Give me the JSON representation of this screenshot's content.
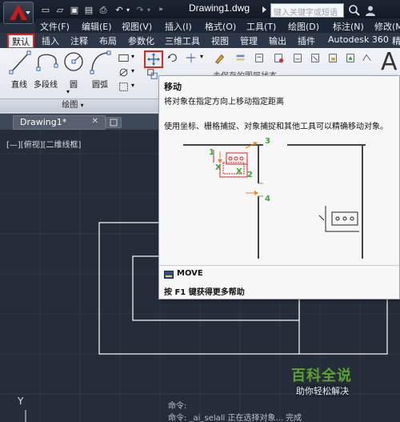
{
  "titlebar": {
    "doc_title": "Drawing1.dwg",
    "search_placeholder": "键入关键字或短语"
  },
  "menubar": {
    "items": [
      "文件(F)",
      "编辑(E)",
      "视图(V)",
      "插入(I)",
      "格式(O)",
      "工具(T)",
      "绘图(D)",
      "标注(N)",
      "修改(M"
    ]
  },
  "ribbon_tabs": {
    "default": "默认",
    "items": [
      "插入",
      "注释",
      "布局",
      "参数化",
      "三维工具",
      "视图",
      "管理",
      "输出",
      "插件",
      "Autodesk 360",
      "精"
    ]
  },
  "ribbon": {
    "tools": {
      "line": "直线",
      "polyline": "多段线",
      "circle": "圆",
      "arc": "圆弧"
    },
    "panel_draw": "绘图",
    "partial_text": "未保存的图层状态",
    "big_letter": "A"
  },
  "doc_tabs": {
    "tab_label": "Drawing1*",
    "close": "✕"
  },
  "canvas": {
    "viewport_label": "[—][俯视][二维线框]",
    "ucs_y": "Y",
    "cmd_line_1": "命令:",
    "cmd_line_2": "命令: _ai_selall 正在选择对象... 完成"
  },
  "tooltip": {
    "title": "移动",
    "desc": "将对象在指定方向上移动指定距离",
    "detail": "使用坐标、栅格捕捉、对象捕捉和其他工具可以精确移动对象。",
    "cmd": "MOVE",
    "help": "按 F1 键获得更多帮助",
    "numbers": [
      "1",
      "2",
      "3",
      "4"
    ]
  },
  "watermark": {
    "main": "百科全说",
    "sub": "助你轻松解决"
  },
  "colors": {
    "accent_red": "#e2241f",
    "canvas_bg": "#252d3b",
    "watermark_green": "#5ba32e",
    "marker_green": "#3aa63a",
    "marker_orange": "#e8832a"
  }
}
